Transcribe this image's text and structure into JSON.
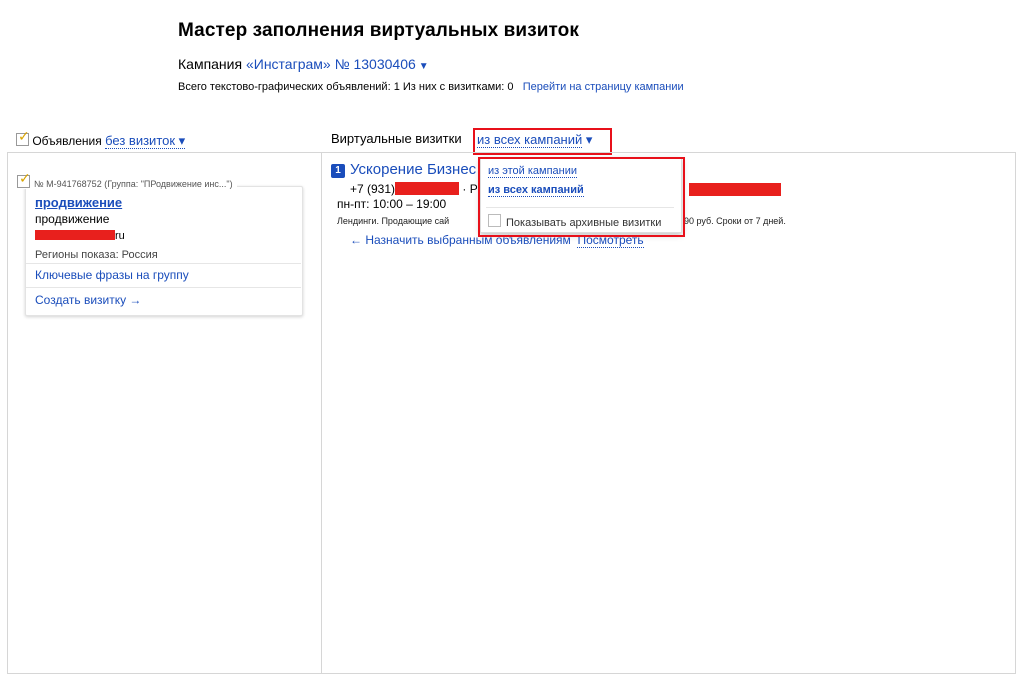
{
  "page": {
    "title": "Мастер заполнения виртуальных визиток",
    "campaign_prefix": "Кампания",
    "campaign_name": "«Инстаграм» № 13030406",
    "stats_text": "Всего текстово-графических объявлений: 1   Из них с визитками: 0",
    "campaign_page_link": "Перейти на страницу кампании"
  },
  "ads_panel": {
    "label": "Объявления",
    "filter": "без визиток",
    "ad": {
      "meta": "№ М-941768752 (Группа: \"ПРодвижение инс...\")",
      "title": "продвижение",
      "text": "продвижение",
      "domain_suffix": "ru",
      "regions": "Регионы показа: Россия",
      "keyphrases_link": "Ключевые фразы на группу",
      "create_vcard_link": "Создать визитку →"
    }
  },
  "vcards_panel": {
    "label": "Виртуальные визитки",
    "filter": "из всех кампаний",
    "vcard": {
      "number": "1",
      "title": "Ускорение Бизнес",
      "phone_prefix": "+7 (931)",
      "phone_sep": "·  P",
      "hours": "пн-пт: 10:00 – 19:00",
      "desc_start": "Лендинги. Продающие сай",
      "desc_end": "90 руб. Сроки от 7 дней.",
      "assign_link": "← Назначить выбранным объявлениям",
      "view_link": "Посмотреть"
    }
  },
  "dropdown": {
    "items": [
      "из этой кампании",
      "из всех кампаний"
    ],
    "archive_label": "Показывать архивные визитки"
  },
  "colors": {
    "link": "#1a4dbb",
    "highlight": "#e8101a",
    "redaction": "#e8201d"
  }
}
